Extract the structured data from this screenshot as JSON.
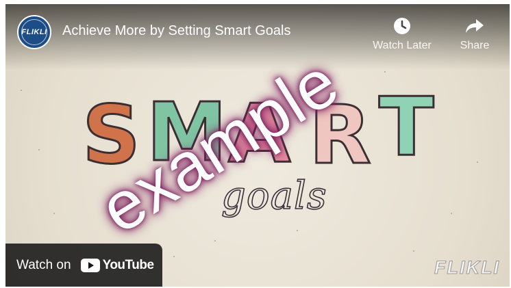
{
  "player": {
    "channel_avatar_text": "FLIKLI",
    "title": "Achieve More by Setting Smart Goals",
    "watch_later_label": "Watch Later",
    "share_label": "Share",
    "watch_on_label": "Watch on",
    "youtube_label": "YouTube",
    "brand_watermark": "FLIKLI",
    "overlay_watermark": "example"
  },
  "video_frame": {
    "smart_letters": [
      "S",
      "M",
      "A",
      "R",
      "T"
    ],
    "goals_text": "goals"
  },
  "colors": {
    "s": "#d0734a",
    "m": "#7fc4a3",
    "a": "#e68ea0",
    "r": "#f0c7c0",
    "t": "#8fd3b4",
    "avatar": "#1d4d86",
    "overlay_glow": "#7a1f5b"
  },
  "icons": {
    "watch_later": "clock-icon",
    "share": "share-arrow-icon",
    "youtube": "youtube-play-icon"
  }
}
